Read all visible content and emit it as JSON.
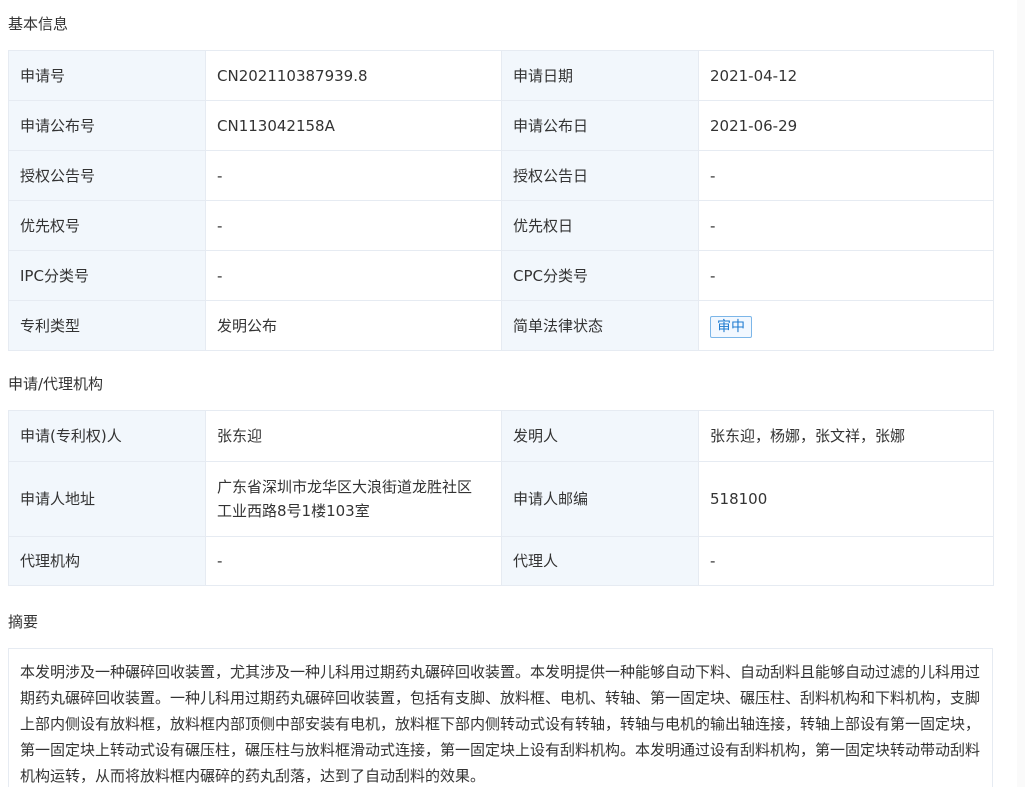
{
  "basic_info": {
    "title": "基本信息",
    "rows": [
      {
        "l1": "申请号",
        "v1": "CN202110387939.8",
        "l2": "申请日期",
        "v2": "2021-04-12"
      },
      {
        "l1": "申请公布号",
        "v1": "CN113042158A",
        "l2": "申请公布日",
        "v2": "2021-06-29"
      },
      {
        "l1": "授权公告号",
        "v1": "-",
        "l2": "授权公告日",
        "v2": "-"
      },
      {
        "l1": "优先权号",
        "v1": "-",
        "l2": "优先权日",
        "v2": "-"
      },
      {
        "l1": "IPC分类号",
        "v1": "-",
        "l2": "CPC分类号",
        "v2": "-"
      },
      {
        "l1": "专利类型",
        "v1": "发明公布",
        "l2": "简单法律状态",
        "v2": "审中"
      }
    ]
  },
  "agency": {
    "title": "申请/代理机构",
    "rows": [
      {
        "l1": "申请(专利权)人",
        "v1": "张东迎",
        "l2": "发明人",
        "v2": "张东迎，杨娜，张文祥，张娜"
      },
      {
        "l1": "申请人地址",
        "v1_line1": "广东省深圳市龙华区大浪街道龙胜社区",
        "v1_line2": "工业西路8号1楼103室",
        "l2": "申请人邮编",
        "v2": "518100"
      },
      {
        "l1": "代理机构",
        "v1": "-",
        "l2": "代理人",
        "v2": "-"
      }
    ]
  },
  "abstract": {
    "title": "摘要",
    "text": "本发明涉及一种碾碎回收装置，尤其涉及一种儿科用过期药丸碾碎回收装置。本发明提供一种能够自动下料、自动刮料且能够自动过滤的儿科用过期药丸碾碎回收装置。一种儿科用过期药丸碾碎回收装置，包括有支脚、放料框、电机、转轴、第一固定块、碾压柱、刮料机构和下料机构，支脚上部内侧设有放料框，放料框内部顶侧中部安装有电机，放料框下部内侧转动式设有转轴，转轴与电机的输出轴连接，转轴上部设有第一固定块，第一固定块上转动式设有碾压柱，碾压柱与放料框滑动式连接，第一固定块上设有刮料机构。本发明通过设有刮料机构，第一固定块转动带动刮料机构运转，从而将放料框内碾碎的药丸刮落，达到了自动刮料的效果。"
  },
  "colors": {
    "label_bg": "#f2f7fc",
    "border": "#e6ebf2",
    "status_tag": "#1f7bd0"
  }
}
